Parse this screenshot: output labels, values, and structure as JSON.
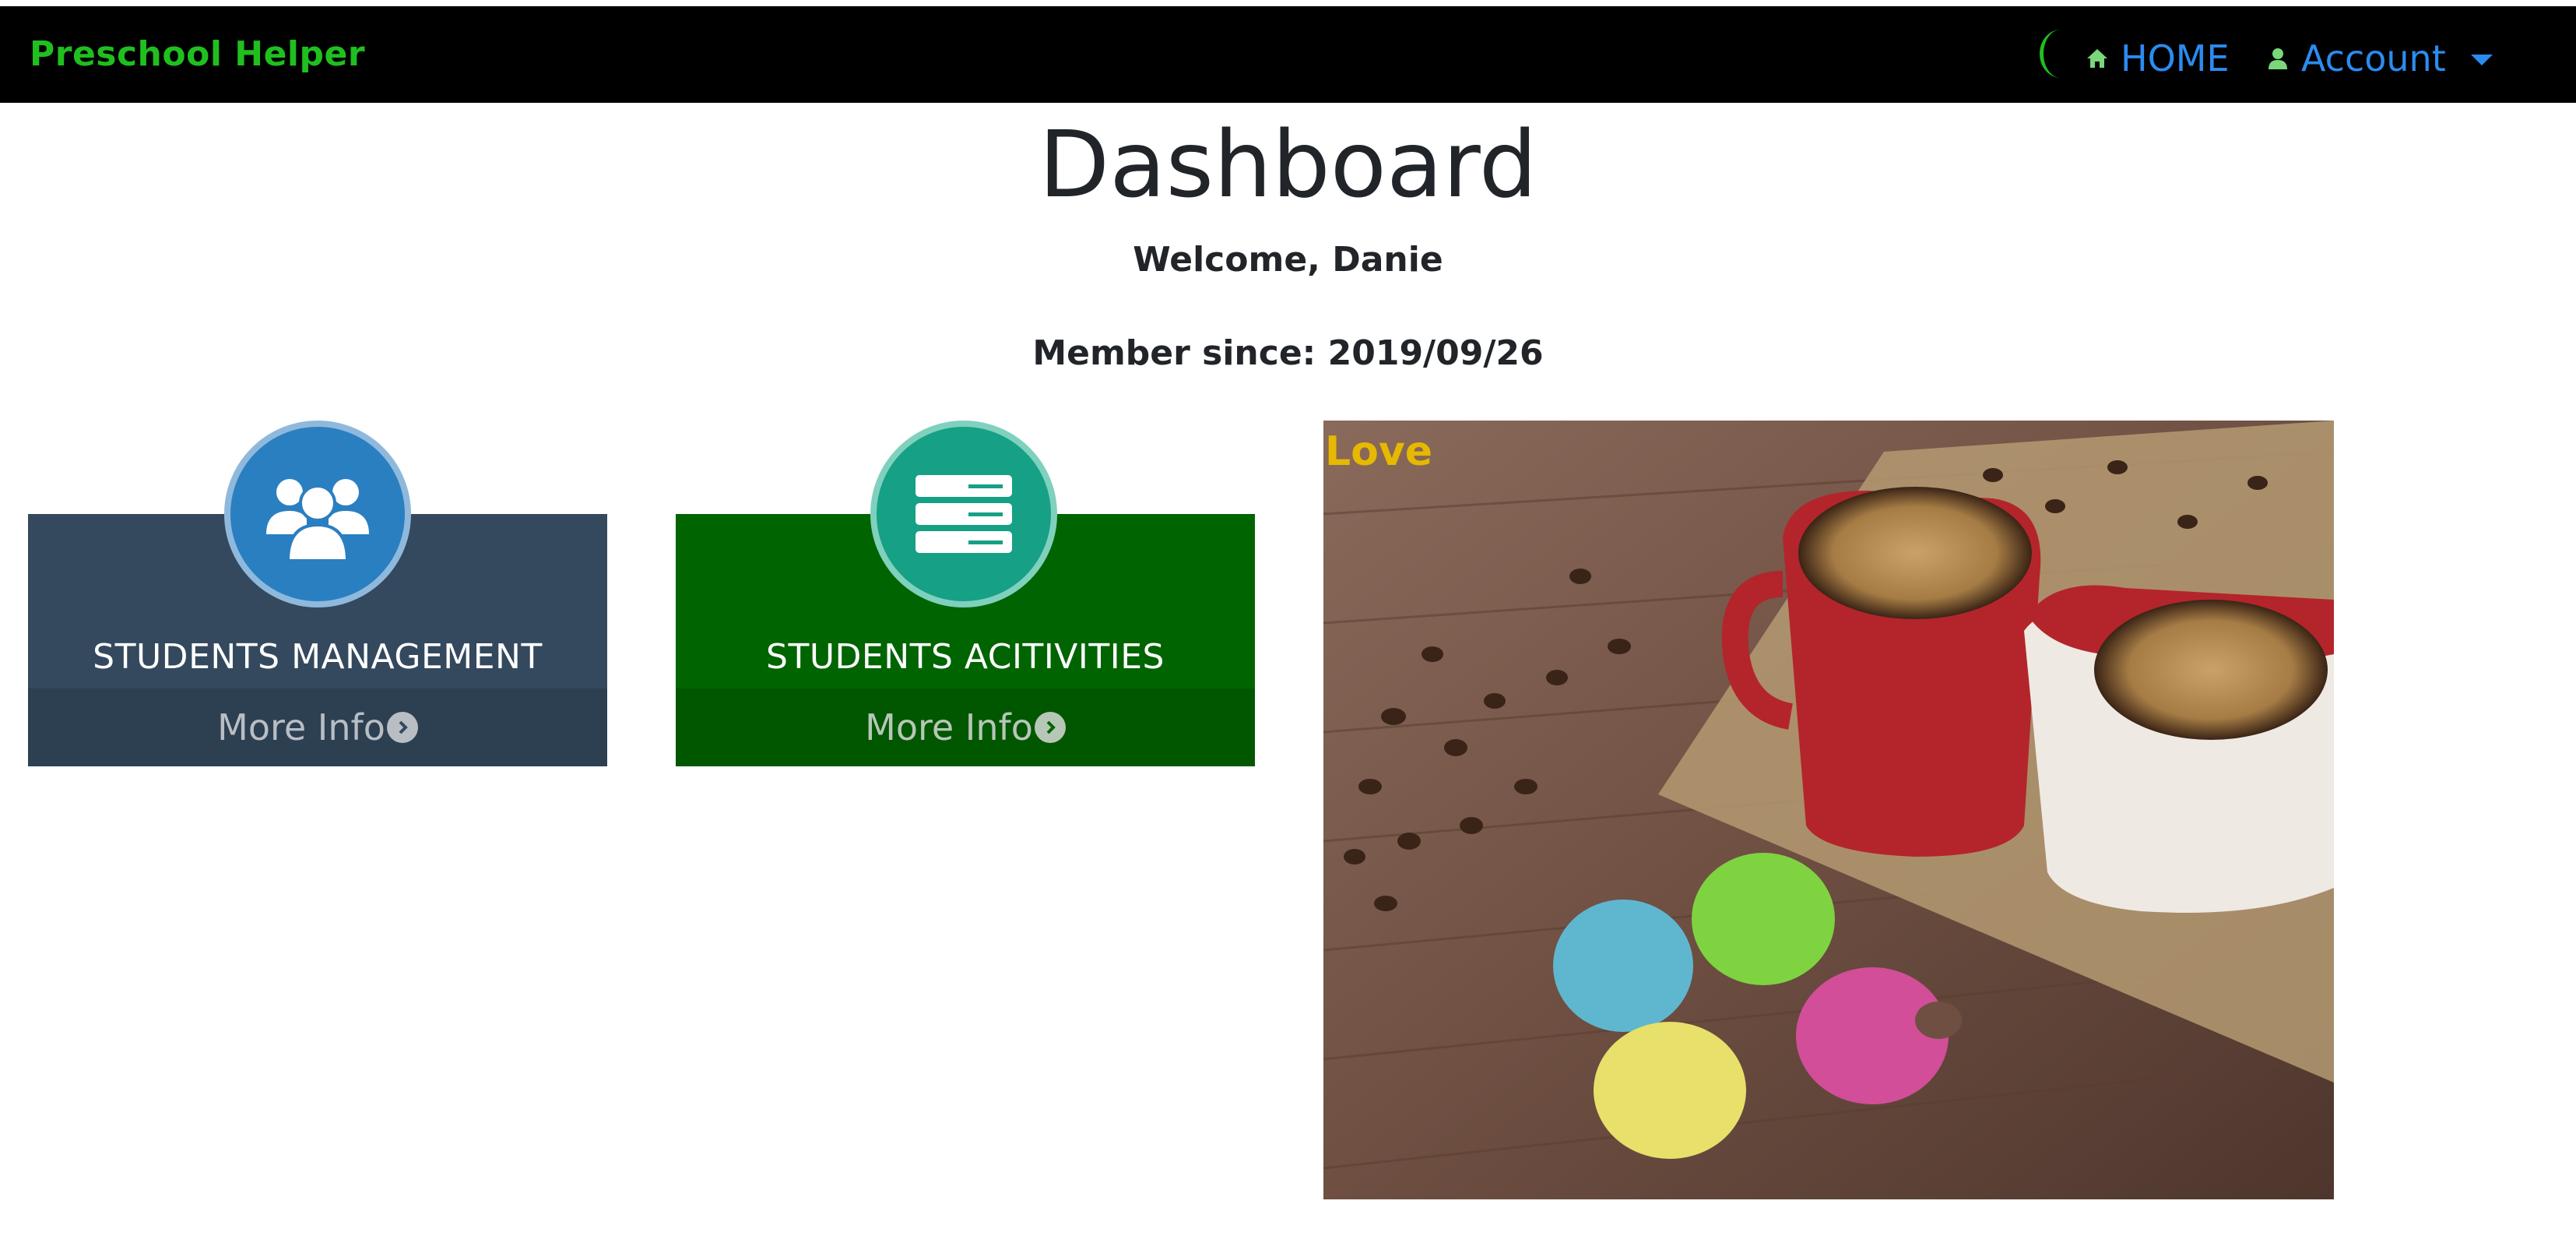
{
  "navbar": {
    "brand": "Preschool Helper",
    "home_label": "HOME",
    "account_label": "Account",
    "icons": {
      "home": "home-icon",
      "account": "user-icon",
      "spinner": "loading-spinner",
      "caret": "caret-down-icon"
    },
    "colors": {
      "brand": "#1fbf1f",
      "link": "#2b8cf0",
      "background": "#000000"
    }
  },
  "header": {
    "title": "Dashboard",
    "welcome": "Welcome, Danie",
    "member_since": "Member since: 2019/09/26"
  },
  "cards": [
    {
      "label": "STUDENTS MANAGEMENT",
      "more_info": "More Info",
      "icon": "users-icon",
      "color": "#34495e",
      "badge_color": "#2a7fc1"
    },
    {
      "label": "STUDENTS ACITIVITIES",
      "more_info": "More Info",
      "icon": "server-list-icon",
      "color": "#006400",
      "badge_color": "#16a085"
    }
  ],
  "photo": {
    "caption": "Love",
    "caption_color": "#e6b800"
  }
}
